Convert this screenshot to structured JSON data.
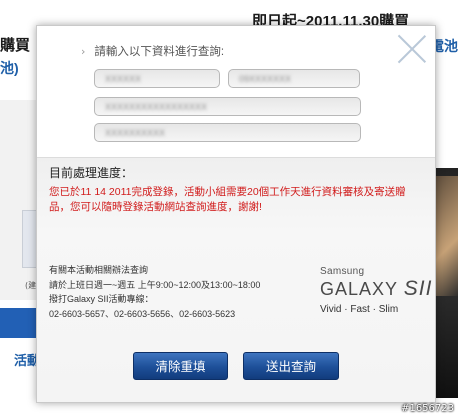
{
  "background": {
    "headline": "即日起~2011.11.30購買",
    "headline_blue": "電池",
    "left_title": "購買",
    "left_sub": "池)",
    "left_link": "活動",
    "left_small": "(建"
  },
  "dialog": {
    "form_title": "請輸入以下資料進行查詢:",
    "fields": [
      {
        "value": "XXXXXX"
      },
      {
        "value": "09XXXXXXX"
      },
      {
        "value": "XXXXXXXXXXXXXXXXX"
      },
      {
        "value": "XXXXXXXXXX"
      }
    ],
    "status_heading": "目前處理進度：",
    "status_message": "您已於11 14 2011完成登錄，活動小組需要20個工作天進行資料審核及寄送贈品，您可以隨時登錄活動網站查詢進度，謝謝!",
    "contact": {
      "line1": "有關本活動相關辦法查詢",
      "line2": "請於上班日週一~週五 上午9:00~12:00及13:00~18:00",
      "line3": "撥打Galaxy SII活動專線：",
      "line4": "02-6603-5657、02-6603-5656、02-6603-5623"
    },
    "brand": {
      "samsung": "Samsung",
      "galaxy": "GALAXY",
      "model": "SII",
      "tagline": "Vivid · Fast · Slim"
    },
    "buttons": {
      "reset": "清除重填",
      "submit": "送出查詢"
    }
  },
  "watermark": "#1656723",
  "colors": {
    "accent_blue": "#1d4f98",
    "status_red": "#d11c1c"
  }
}
